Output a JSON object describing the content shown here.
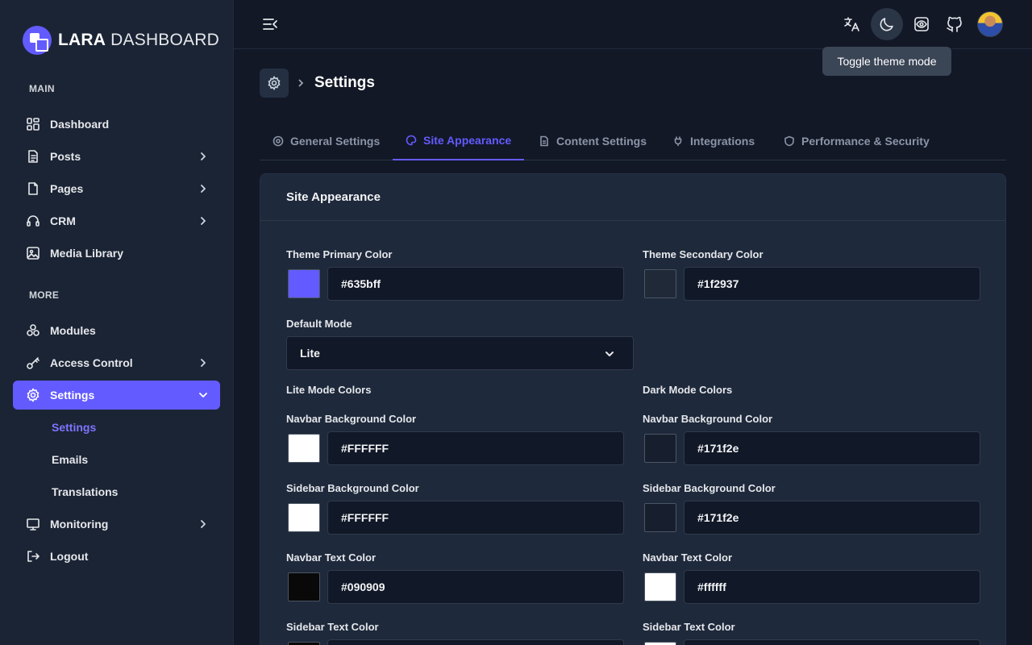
{
  "brand": {
    "bold": "LARA",
    "light": " DASHBOARD"
  },
  "sidebar": {
    "section_main": "MAIN",
    "section_more": "MORE",
    "items": [
      {
        "label": "Dashboard"
      },
      {
        "label": "Posts"
      },
      {
        "label": "Pages"
      },
      {
        "label": "CRM"
      },
      {
        "label": "Media Library"
      },
      {
        "label": "Modules"
      },
      {
        "label": "Access Control"
      },
      {
        "label": "Settings"
      },
      {
        "label": "Monitoring"
      },
      {
        "label": "Logout"
      }
    ],
    "sub_items": [
      {
        "label": "Settings"
      },
      {
        "label": "Emails"
      },
      {
        "label": "Translations"
      }
    ]
  },
  "topbar": {
    "tooltip": "Toggle theme mode",
    "icons": [
      "translate-icon",
      "moon-icon",
      "eye-scan-icon",
      "github-icon"
    ]
  },
  "breadcrumb": {
    "title": "Settings"
  },
  "tabs": [
    {
      "label": "General Settings"
    },
    {
      "label": "Site Appearance"
    },
    {
      "label": "Content Settings"
    },
    {
      "label": "Integrations"
    },
    {
      "label": "Performance & Security"
    }
  ],
  "card": {
    "title": "Site Appearance",
    "primary_label": "Theme Primary Color",
    "primary_value": "#635bff",
    "primary_swatch": "#635bff",
    "secondary_label": "Theme Secondary Color",
    "secondary_value": "#1f2937",
    "secondary_swatch": "#1f2937",
    "default_mode_label": "Default Mode",
    "default_mode_value": "Lite",
    "lite_heading": "Lite Mode Colors",
    "dark_heading": "Dark Mode Colors",
    "lite": {
      "navbar_bg_label": "Navbar Background Color",
      "navbar_bg_value": "#FFFFFF",
      "navbar_bg_swatch": "#ffffff",
      "sidebar_bg_label": "Sidebar Background Color",
      "sidebar_bg_value": "#FFFFFF",
      "sidebar_bg_swatch": "#ffffff",
      "navbar_text_label": "Navbar Text Color",
      "navbar_text_value": "#090909",
      "navbar_text_swatch": "#090909",
      "sidebar_text_label": "Sidebar Text Color",
      "sidebar_text_swatch": "#090909"
    },
    "dark": {
      "navbar_bg_label": "Navbar Background Color",
      "navbar_bg_value": "#171f2e",
      "navbar_bg_swatch": "#171f2e",
      "sidebar_bg_label": "Sidebar Background Color",
      "sidebar_bg_value": "#171f2e",
      "sidebar_bg_swatch": "#171f2e",
      "navbar_text_label": "Navbar Text Color",
      "navbar_text_value": "#ffffff",
      "navbar_text_swatch": "#ffffff",
      "sidebar_text_label": "Sidebar Text Color",
      "sidebar_text_swatch": "#ffffff"
    }
  },
  "colors": {
    "accent": "#635bff"
  }
}
